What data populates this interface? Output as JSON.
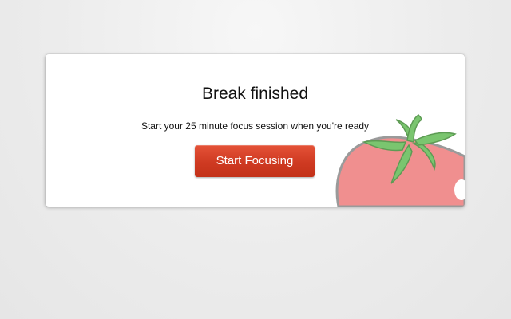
{
  "dialog": {
    "title": "Break finished",
    "message": "Start your 25 minute focus session when you're ready",
    "start_button_label": "Start Focusing"
  },
  "illustration": {
    "icon": "tomato-icon",
    "fruit_color": "#f08f8f",
    "stem_color": "#7ac56f"
  },
  "colors": {
    "accent": "#cf3a22",
    "card_background": "#ffffff",
    "page_background": "#ececec"
  }
}
